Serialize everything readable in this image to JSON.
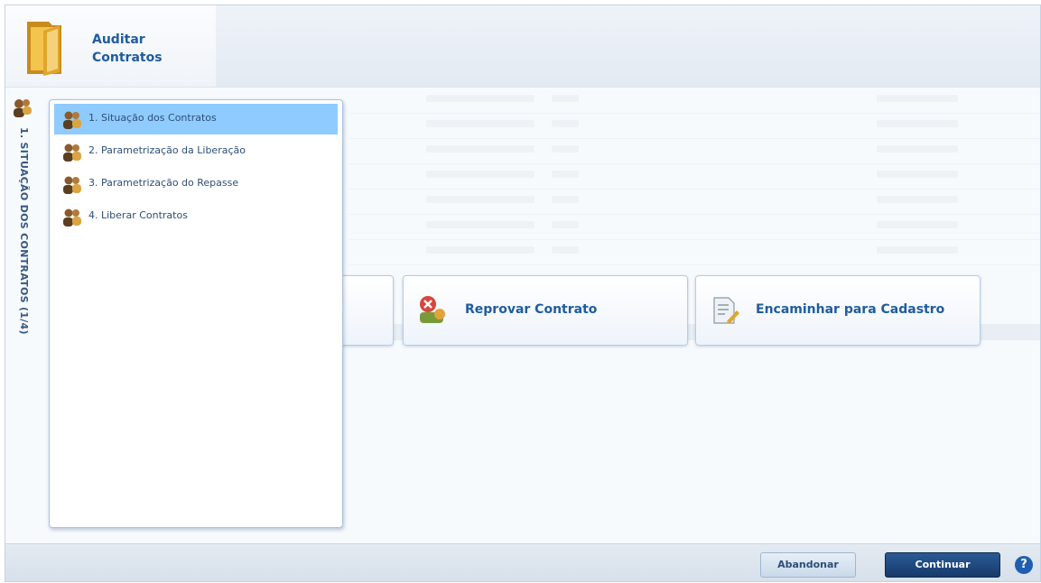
{
  "header": {
    "title_line1": "Auditar",
    "title_line2": "Contratos"
  },
  "rail": {
    "label": "1. SITUAÇÃO DOS CONTRATOS (1/4)"
  },
  "menu": {
    "items": [
      {
        "label": "1. Situação dos Contratos",
        "selected": true
      },
      {
        "label": "2. Parametrização da Liberação",
        "selected": false
      },
      {
        "label": "3. Parametrização do Repasse",
        "selected": false
      },
      {
        "label": "4. Liberar Contratos",
        "selected": false
      }
    ]
  },
  "actions": {
    "reprovar": "Reprovar Contrato",
    "encaminhar": "Encaminhar para Cadastro"
  },
  "footer": {
    "abandon": "Abandonar",
    "continue": "Continuar",
    "help": "?"
  },
  "colors": {
    "accent": "#1f5c9e",
    "selected": "#8fcbff",
    "primary_button": "#1f4a80"
  }
}
